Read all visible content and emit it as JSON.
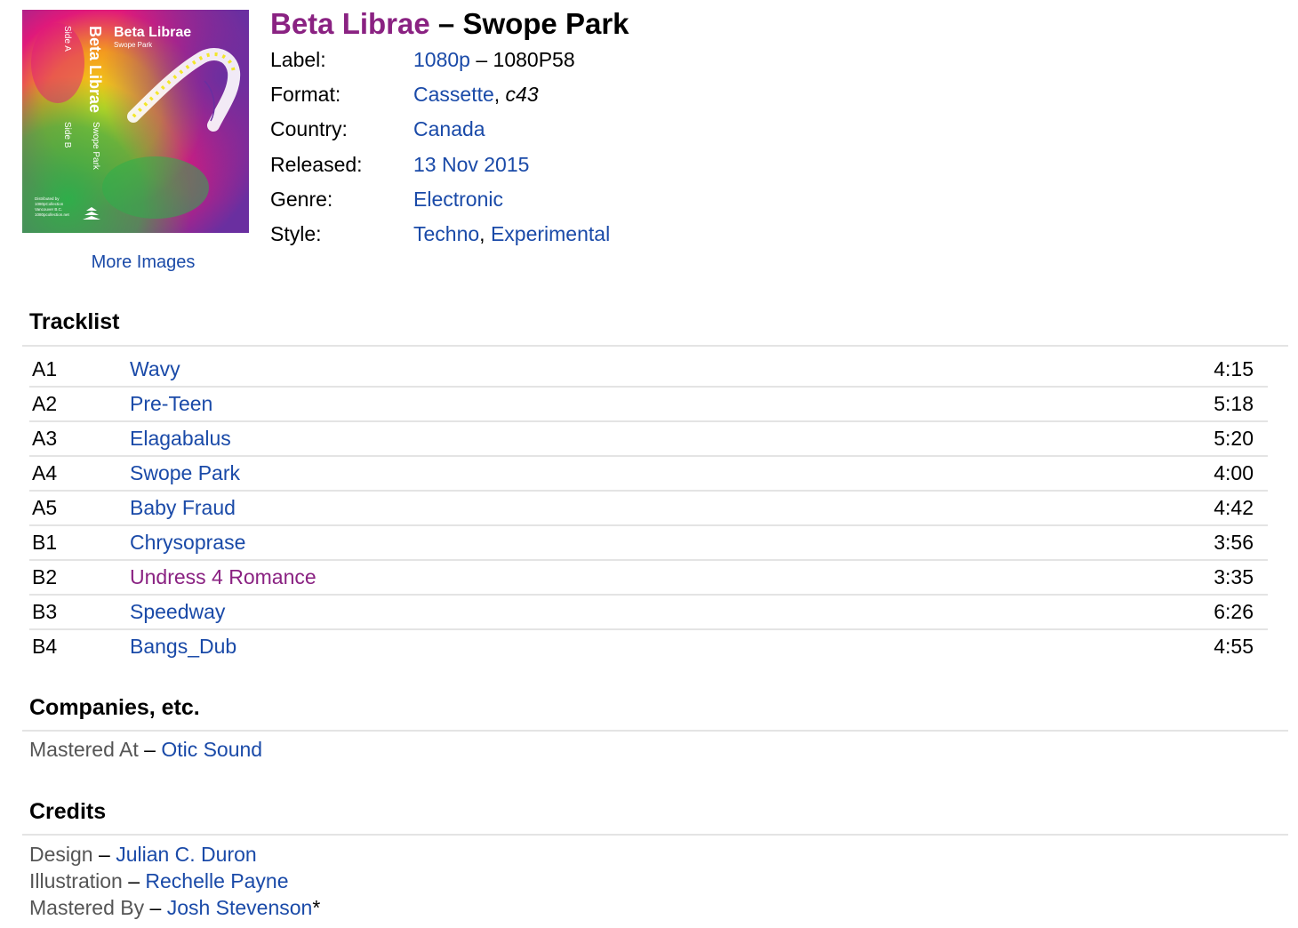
{
  "release": {
    "artist": "Beta Librae",
    "separator": " – ",
    "title": "Swope Park"
  },
  "cover": {
    "more_images_label": "More Images",
    "artwork_text": {
      "artist": "Beta Librae",
      "title": "Swope Park",
      "side_a": "Side A",
      "side_b": "Side B",
      "spine_artist": "Beta Librae",
      "spine_title": "Swope Park",
      "distribution": [
        "Distributed by",
        "1080pCollection",
        "Vancouver B.C.",
        "1080pcollection.net"
      ]
    },
    "colors": {
      "magenta": "#e0197a",
      "purple": "#6a2fa0",
      "green": "#2fae4a",
      "yellow": "#f2e614",
      "orange": "#f39a1f"
    }
  },
  "profile": {
    "label": {
      "key": "Label:",
      "name": "1080p",
      "separator": " – ",
      "catno": "1080P58"
    },
    "format": {
      "key": "Format:",
      "name": "Cassette",
      "separator": ", ",
      "description": "c43"
    },
    "country": {
      "key": "Country:",
      "value": "Canada"
    },
    "released": {
      "key": "Released:",
      "value": "13 Nov 2015"
    },
    "genre": {
      "key": "Genre:",
      "value": "Electronic"
    },
    "style": {
      "key": "Style:",
      "values": [
        "Techno",
        "Experimental"
      ],
      "separator": ", "
    }
  },
  "tracklist": {
    "heading": "Tracklist",
    "tracks": [
      {
        "position": "A1",
        "title": "Wavy",
        "duration": "4:15",
        "visited": false
      },
      {
        "position": "A2",
        "title": "Pre-Teen",
        "duration": "5:18",
        "visited": false
      },
      {
        "position": "A3",
        "title": "Elagabalus",
        "duration": "5:20",
        "visited": false
      },
      {
        "position": "A4",
        "title": "Swope Park",
        "duration": "4:00",
        "visited": false
      },
      {
        "position": "A5",
        "title": "Baby Fraud",
        "duration": "4:42",
        "visited": false
      },
      {
        "position": "B1",
        "title": "Chrysoprase",
        "duration": "3:56",
        "visited": false
      },
      {
        "position": "B2",
        "title": "Undress 4 Romance",
        "duration": "3:35",
        "visited": true
      },
      {
        "position": "B3",
        "title": "Speedway",
        "duration": "6:26",
        "visited": false
      },
      {
        "position": "B4",
        "title": "Bangs_Dub",
        "duration": "4:55",
        "visited": false
      }
    ]
  },
  "companies": {
    "heading": "Companies, etc.",
    "items": [
      {
        "role": "Mastered At",
        "separator": " – ",
        "name": "Otic Sound"
      }
    ]
  },
  "credits": {
    "heading": "Credits",
    "items": [
      {
        "role": "Design",
        "separator": " – ",
        "name": "Julian C. Duron",
        "anv": ""
      },
      {
        "role": "Illustration",
        "separator": " – ",
        "name": "Rechelle Payne",
        "anv": ""
      },
      {
        "role": "Mastered By",
        "separator": " – ",
        "name": "Josh Stevenson",
        "anv": "*"
      }
    ]
  },
  "colors": {
    "link": "#1a4aa8",
    "visited_link": "#8a2282",
    "artist_heading": "#8a2282",
    "divider": "#e4e4e4",
    "muted_text": "#555555"
  }
}
